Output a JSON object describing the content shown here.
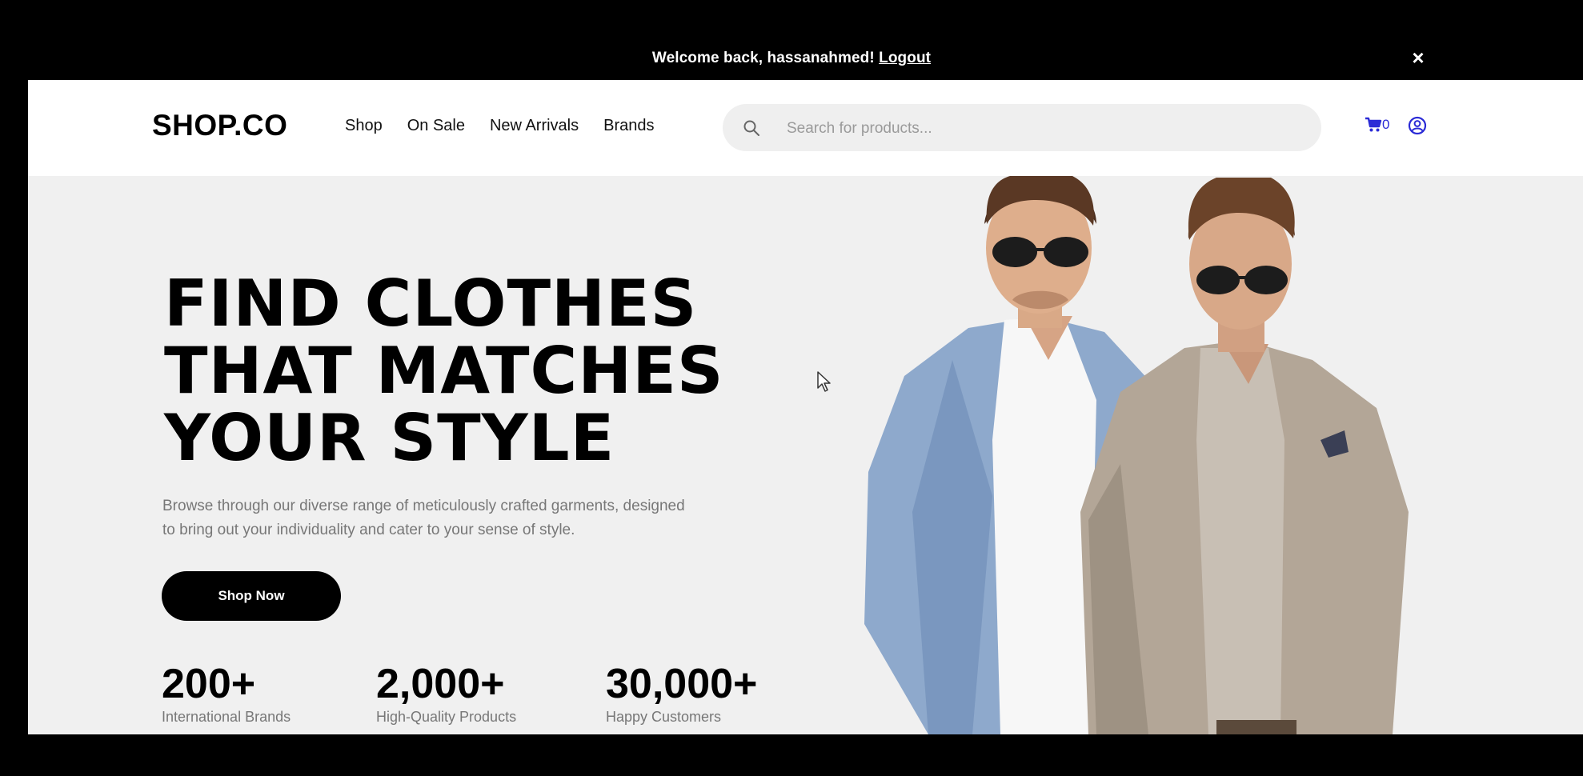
{
  "announcement": {
    "welcome_text": "Welcome back, hassanahmed!",
    "logout_label": "Logout",
    "close_label": "×"
  },
  "header": {
    "logo": "SHOP.CO",
    "nav": [
      {
        "label": "Shop"
      },
      {
        "label": "On Sale"
      },
      {
        "label": "New Arrivals"
      },
      {
        "label": "Brands"
      }
    ],
    "search": {
      "placeholder": "Search for products...",
      "value": "",
      "icon": "search-icon"
    },
    "cart": {
      "icon": "cart-icon",
      "count": "0"
    },
    "user_icon": "user-icon"
  },
  "hero": {
    "headline": [
      "FIND CLOTHES",
      "THAT MATCHES",
      "YOUR STYLE"
    ],
    "description_lines": [
      "Browse through our diverse range of meticulously crafted garments, designed",
      "to bring out your individuality and cater to your sense of style."
    ],
    "cta_label": "Shop Now",
    "stats": [
      {
        "value": "200+",
        "label": "International Brands"
      },
      {
        "value": "2,000+",
        "label": "High-Quality Products"
      },
      {
        "value": "30,000+",
        "label": "Happy Customers"
      }
    ],
    "image": "two-models-in-blazers"
  },
  "colors": {
    "page_bg": "#000000",
    "hero_bg": "#f0f0f0",
    "accent": "#2b2bd6",
    "button_bg": "#000000"
  }
}
